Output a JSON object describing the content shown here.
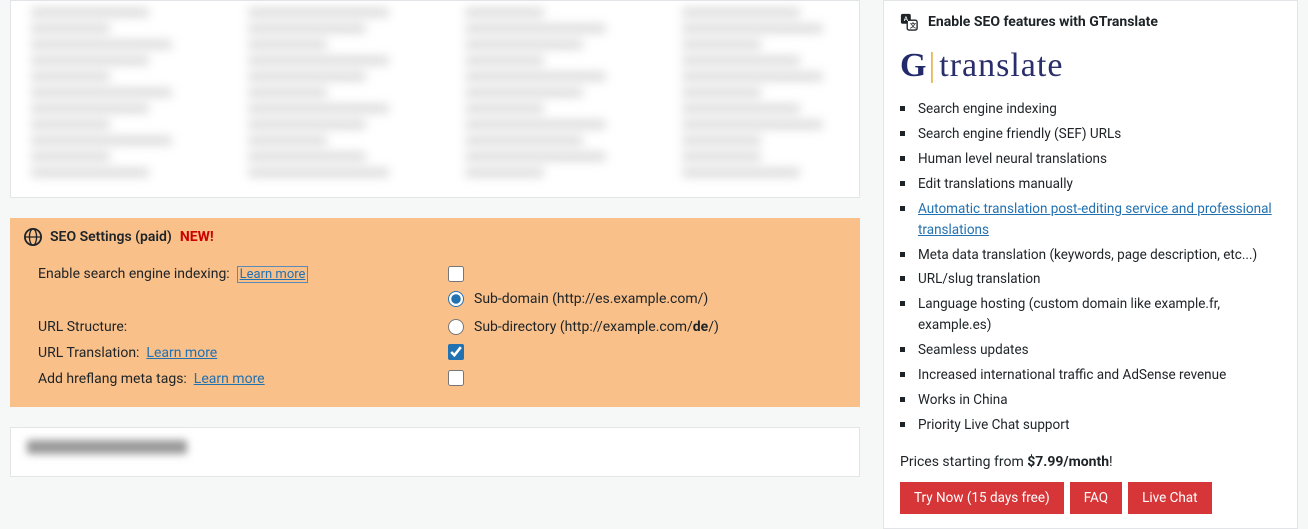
{
  "seo_panel": {
    "title": "SEO Settings (paid)",
    "badge_new": "NEW!",
    "rows": {
      "indexing": {
        "label": "Enable search engine indexing:",
        "learn": "Learn more"
      },
      "url_structure": {
        "label": "URL Structure:",
        "opt_subdomain": "Sub-domain (http://es.example.com/)",
        "opt_subdir_prefix": "Sub-directory (http://example.com/",
        "opt_subdir_bold": "de",
        "opt_subdir_suffix": "/)"
      },
      "url_translation": {
        "label": "URL Translation:",
        "learn": "Learn more"
      },
      "hreflang": {
        "label": "Add hreflang meta tags:",
        "learn": "Learn more"
      }
    }
  },
  "sidebar": {
    "header": "Enable SEO features with GTranslate",
    "brand_g": "G",
    "brand_text": "translate",
    "features": [
      "Search engine indexing",
      "Search engine friendly (SEF) URLs",
      "Human level neural translations",
      "Edit translations manually",
      "Automatic translation post-editing service and professional translations",
      "Meta data translation (keywords, page description, etc...)",
      "URL/slug translation",
      "Language hosting (custom domain like example.fr, example.es)",
      "Seamless updates",
      "Increased international traffic and AdSense revenue",
      "Works in China",
      "Priority Live Chat support"
    ],
    "feature_link_index": 4,
    "price_prefix": "Prices starting from ",
    "price_value": "$7.99/month",
    "price_suffix": "!",
    "buttons": {
      "try": "Try Now (15 days free)",
      "faq": "FAQ",
      "chat": "Live Chat"
    }
  }
}
